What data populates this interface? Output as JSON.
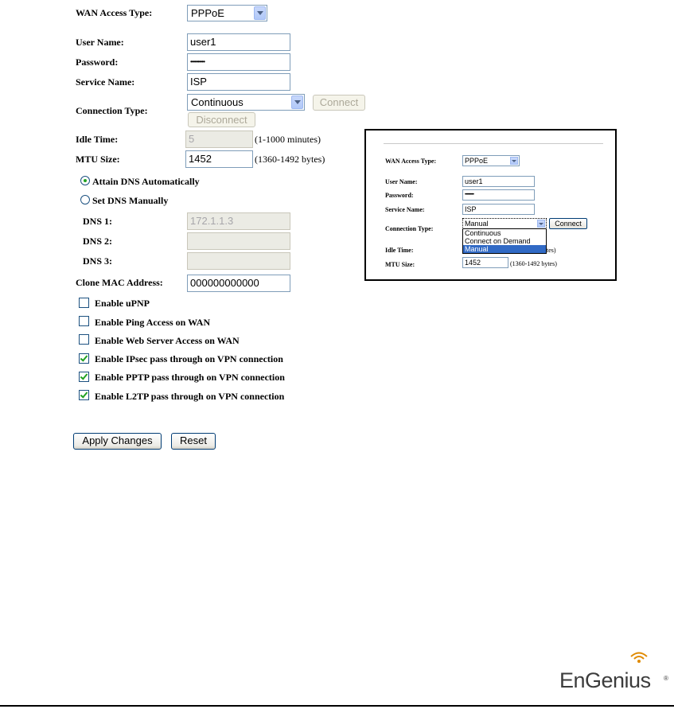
{
  "form": {
    "wan_access_type": {
      "label": "WAN Access Type:",
      "value": "PPPoE"
    },
    "user_name": {
      "label": "User Name:",
      "value": "user1"
    },
    "password": {
      "label": "Password:",
      "value": "••••••••••"
    },
    "service_name": {
      "label": "Service Name:",
      "value": "ISP"
    },
    "connection_type": {
      "label": "Connection Type:",
      "value": "Continuous",
      "connect_label": "Connect",
      "disconnect_label": "Disconnect"
    },
    "idle_time": {
      "label": "Idle Time:",
      "value": "5",
      "hint": "(1-1000 minutes)"
    },
    "mtu_size": {
      "label": "MTU Size:",
      "value": "1452",
      "hint": "(1360-1492 bytes)"
    },
    "dns_auto": {
      "label": "Attain DNS Automatically",
      "checked": true
    },
    "dns_manual": {
      "label": "Set DNS Manually",
      "checked": false
    },
    "dns1": {
      "label": "DNS 1:",
      "value": "172.1.1.3"
    },
    "dns2": {
      "label": "DNS 2:",
      "value": ""
    },
    "dns3": {
      "label": "DNS 3:",
      "value": ""
    },
    "clone_mac": {
      "label": "Clone MAC Address:",
      "value": "000000000000"
    },
    "checkboxes": [
      {
        "label": "Enable uPNP",
        "checked": false
      },
      {
        "label": "Enable Ping Access on WAN",
        "checked": false
      },
      {
        "label": "Enable Web Server Access on WAN",
        "checked": false
      },
      {
        "label": "Enable IPsec pass through on VPN connection",
        "checked": true
      },
      {
        "label": "Enable PPTP pass through on VPN connection",
        "checked": true
      },
      {
        "label": "Enable L2TP pass through on VPN connection",
        "checked": true
      }
    ],
    "apply_label": "Apply Changes",
    "reset_label": "Reset"
  },
  "inset": {
    "wan_access_type": {
      "label": "WAN Access Type:",
      "value": "PPPoE"
    },
    "user_name": {
      "label": "User Name:",
      "value": "user1"
    },
    "password": {
      "label": "Password:",
      "value": "••••••••••"
    },
    "service_name": {
      "label": "Service Name:",
      "value": "ISP"
    },
    "connection_type": {
      "label": "Connection Type:",
      "value": "Manual",
      "connect_label": "Connect"
    },
    "dropdown_options": [
      "Continuous",
      "Connect on Demand",
      "Manual"
    ],
    "idle_time": {
      "label": "Idle Time:",
      "hint_fragment": "tes)"
    },
    "mtu_size": {
      "label": "MTU Size:",
      "value": "1452",
      "hint": "(1360-1492 bytes)"
    }
  },
  "brand": {
    "logo_text": "EnGenius",
    "trademark": "®"
  }
}
